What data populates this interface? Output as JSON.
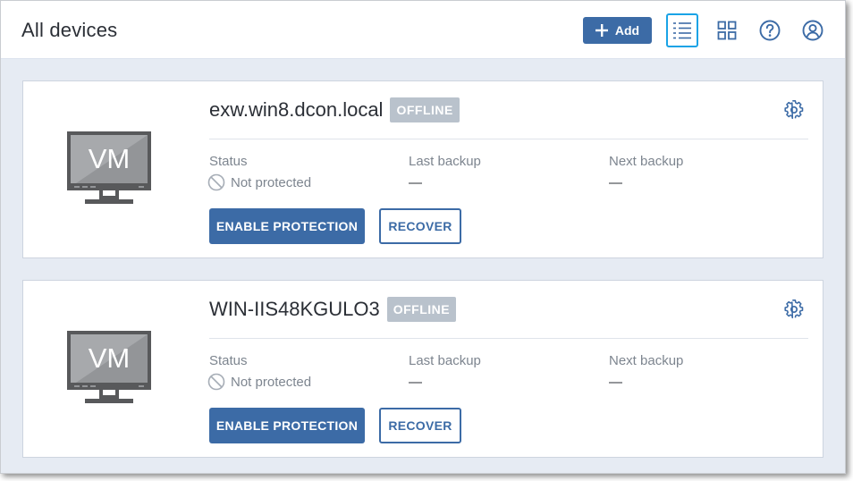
{
  "header": {
    "title": "All devices",
    "add_label": "Add",
    "icons": [
      "list-view-icon",
      "grid-view-icon",
      "help-icon",
      "account-icon"
    ]
  },
  "colors": {
    "primary": "#3c6ba6",
    "active_outline": "#1aa3e6",
    "badge": "#b9c2cc",
    "background": "#e6ebf3"
  },
  "devices": [
    {
      "name": "exw.win8.dcon.local",
      "badge": "OFFLINE",
      "vm_label": "VM",
      "status_label": "Status",
      "status_value": "Not protected",
      "last_backup_label": "Last backup",
      "last_backup_value": "—",
      "next_backup_label": "Next backup",
      "next_backup_value": "—",
      "enable_label": "ENABLE PROTECTION",
      "recover_label": "RECOVER"
    },
    {
      "name": "WIN-IIS48KGULO3",
      "badge": "OFFLINE",
      "vm_label": "VM",
      "status_label": "Status",
      "status_value": "Not protected",
      "last_backup_label": "Last backup",
      "last_backup_value": "—",
      "next_backup_label": "Next backup",
      "next_backup_value": "—",
      "enable_label": "ENABLE PROTECTION",
      "recover_label": "RECOVER"
    }
  ]
}
